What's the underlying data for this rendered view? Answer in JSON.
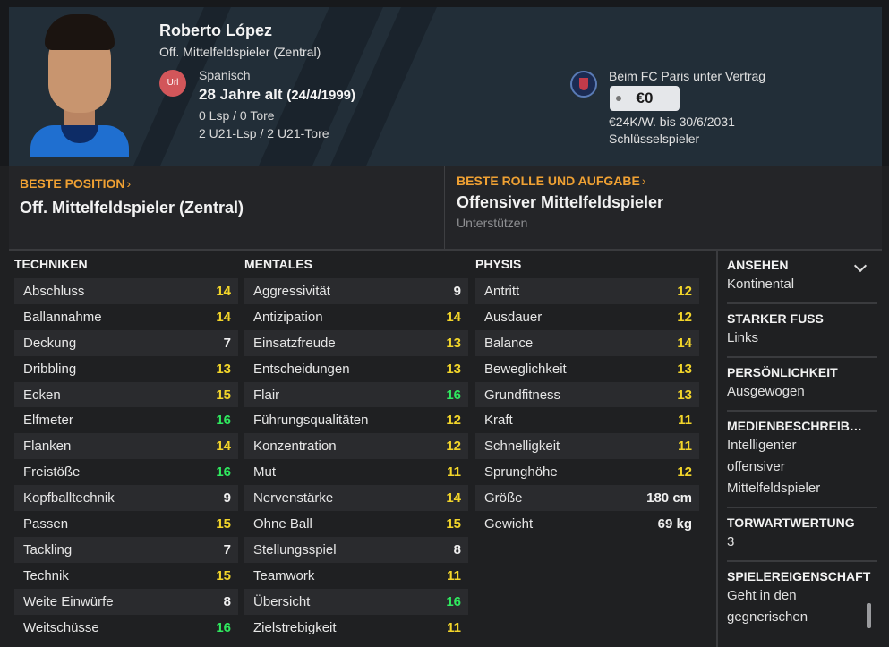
{
  "player": {
    "name": "Roberto López",
    "position": "Off. Mittelfeldspieler (Zentral)",
    "nationality_badge": "Url",
    "nationality": "Spanisch",
    "age": "28 Jahre alt",
    "dob": "(24/4/1999)",
    "caps": "0 Lsp / 0 Tore",
    "u21": "2 U21-Lsp / 2 U21-Tore"
  },
  "contract": {
    "club_text": "Beim FC Paris unter Vertrag",
    "value": "€0",
    "wage": "€24K/W. bis 30/6/2031",
    "status": "Schlüsselspieler"
  },
  "best_position": {
    "title": "BESTE POSITION",
    "value": "Off. Mittelfeldspieler (Zentral)"
  },
  "best_role": {
    "title": "BESTE ROLLE UND AUFGABE",
    "value": "Offensiver Mittelfeldspieler",
    "duty": "Unterstützen"
  },
  "columns": [
    {
      "title": "TECHNIKEN",
      "rows": [
        {
          "label": "Abschluss",
          "value": "14",
          "color": "y"
        },
        {
          "label": "Ballannahme",
          "value": "14",
          "color": "y"
        },
        {
          "label": "Deckung",
          "value": "7",
          "color": "w"
        },
        {
          "label": "Dribbling",
          "value": "13",
          "color": "y"
        },
        {
          "label": "Ecken",
          "value": "15",
          "color": "y"
        },
        {
          "label": "Elfmeter",
          "value": "16",
          "color": "g"
        },
        {
          "label": "Flanken",
          "value": "14",
          "color": "y"
        },
        {
          "label": "Freistöße",
          "value": "16",
          "color": "g"
        },
        {
          "label": "Kopfballtechnik",
          "value": "9",
          "color": "w"
        },
        {
          "label": "Passen",
          "value": "15",
          "color": "y"
        },
        {
          "label": "Tackling",
          "value": "7",
          "color": "w"
        },
        {
          "label": "Technik",
          "value": "15",
          "color": "y"
        },
        {
          "label": "Weite Einwürfe",
          "value": "8",
          "color": "w"
        },
        {
          "label": "Weitschüsse",
          "value": "16",
          "color": "g"
        }
      ]
    },
    {
      "title": "MENTALES",
      "rows": [
        {
          "label": "Aggressivität",
          "value": "9",
          "color": "w"
        },
        {
          "label": "Antizipation",
          "value": "14",
          "color": "y"
        },
        {
          "label": "Einsatzfreude",
          "value": "13",
          "color": "y"
        },
        {
          "label": "Entscheidungen",
          "value": "13",
          "color": "y"
        },
        {
          "label": "Flair",
          "value": "16",
          "color": "g"
        },
        {
          "label": "Führungsqualitäten",
          "value": "12",
          "color": "y"
        },
        {
          "label": "Konzentration",
          "value": "12",
          "color": "y"
        },
        {
          "label": "Mut",
          "value": "11",
          "color": "y"
        },
        {
          "label": "Nervenstärke",
          "value": "14",
          "color": "y"
        },
        {
          "label": "Ohne Ball",
          "value": "15",
          "color": "y"
        },
        {
          "label": "Stellungsspiel",
          "value": "8",
          "color": "w"
        },
        {
          "label": "Teamwork",
          "value": "11",
          "color": "y"
        },
        {
          "label": "Übersicht",
          "value": "16",
          "color": "g"
        },
        {
          "label": "Zielstrebigkeit",
          "value": "11",
          "color": "y"
        }
      ]
    },
    {
      "title": "PHYSIS",
      "rows": [
        {
          "label": "Antritt",
          "value": "12",
          "color": "y"
        },
        {
          "label": "Ausdauer",
          "value": "12",
          "color": "y"
        },
        {
          "label": "Balance",
          "value": "14",
          "color": "y"
        },
        {
          "label": "Beweglichkeit",
          "value": "13",
          "color": "y"
        },
        {
          "label": "Grundfitness",
          "value": "13",
          "color": "y"
        },
        {
          "label": "Kraft",
          "value": "11",
          "color": "y"
        },
        {
          "label": "Schnelligkeit",
          "value": "11",
          "color": "y"
        },
        {
          "label": "Sprunghöhe",
          "value": "12",
          "color": "y"
        },
        {
          "label": "Größe",
          "value": "180 cm",
          "color": "w"
        },
        {
          "label": "Gewicht",
          "value": "69 kg",
          "color": "w"
        }
      ]
    }
  ],
  "sidebar": [
    {
      "title": "ANSEHEN",
      "value": "Kontinental"
    },
    {
      "title": "STARKER FUSS",
      "value": "Links"
    },
    {
      "title": "PERSÖNLICHKEIT",
      "value": "Ausgewogen"
    },
    {
      "title": "MEDIENBESCHREIB…",
      "value": "Intelligenter offensiver Mittelfeldspieler"
    },
    {
      "title": "TORWARTWERTUNG",
      "value": "3"
    },
    {
      "title": "SPIELEREIGENSCHAFT",
      "value": "Geht in den gegnerischen"
    }
  ],
  "colors": {
    "yellow": "#f2d52a",
    "green": "#2fe85e",
    "accent": "#f0a133"
  }
}
